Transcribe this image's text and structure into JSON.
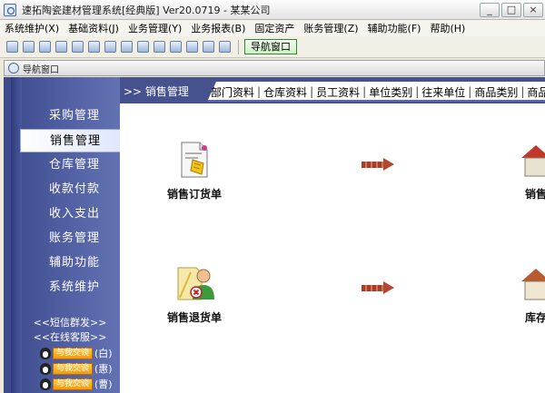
{
  "window": {
    "title": "速拓陶瓷建材管理系统[经典版] Ver20.0719 - 某某公司",
    "minimize": "_",
    "maximize": "□",
    "close": "×"
  },
  "menu": [
    "系统维护(X)",
    "基础资料(J)",
    "业务管理(Y)",
    "业务报表(B)",
    "固定资产",
    "账务管理(Z)",
    "辅助功能(F)",
    "帮助(H)"
  ],
  "toolbar": {
    "icons": [
      "calculator-icon",
      "notepad-icon",
      "document-icon",
      "monitor-icon",
      "edit-icon",
      "tools-icon",
      "network-icon",
      "print-preview-icon",
      "folder-icon",
      "save-icon",
      "disk-icon",
      "printer-icon",
      "help-icon",
      "exit-icon"
    ],
    "nav_button": "导航窗口"
  },
  "nav_window": {
    "title": "导航窗口"
  },
  "sidebar": {
    "items": [
      "采购管理",
      "销售管理",
      "仓库管理",
      "收款付款",
      "收入支出",
      "账务管理",
      "辅助功能",
      "系统维护"
    ],
    "active_index": 1,
    "sms_link": "<<短信群发>>",
    "service_link": "<<在线客服>>",
    "qq_button": "与我交谈",
    "qq_contacts": [
      "(白)",
      "(惠)",
      "(曹)"
    ]
  },
  "tabs": {
    "module_label": ">> 销售管理",
    "links": [
      "部门资料",
      "仓库资料",
      "员工资料",
      "单位类别",
      "往来单位",
      "商品类别",
      "商品资"
    ]
  },
  "content": {
    "functions": [
      {
        "label": "销售订货单",
        "icon": "order-document-icon"
      },
      {
        "label": "销售退货单",
        "icon": "return-document-icon"
      },
      {
        "label": "销售",
        "icon": "store-icon"
      },
      {
        "label": "库存",
        "icon": "warehouse-icon"
      }
    ]
  },
  "colors": {
    "sidebar_bg": "#4a5898",
    "active_item_bg": "#ffffff",
    "arrow": "#b04a30",
    "nav_button_border": "#2f8a2f"
  }
}
